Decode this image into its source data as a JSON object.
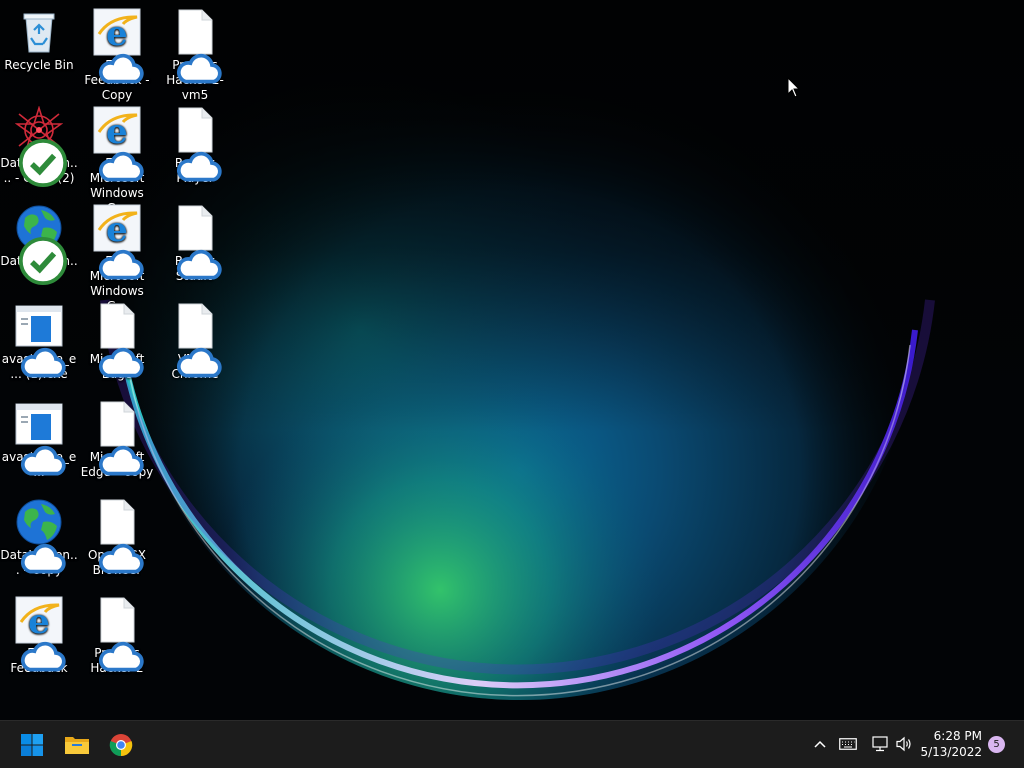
{
  "desktop": {
    "icons": [
      {
        "label": "Recycle Bin",
        "icon": "recycle-bin-icon",
        "badge": "none"
      },
      {
        "label": "EC2 Feedback - Copy",
        "icon": "internet-explorer-icon",
        "badge": "cloud"
      },
      {
        "label": "Process Hacker 2-vm5",
        "icon": "blank-file-icon",
        "badge": "cloud"
      },
      {
        "label": "DataWagon.... - Copy (2)",
        "icon": "red-star-icon",
        "badge": "check"
      },
      {
        "label": "EC2 Microsoft Windows G...",
        "icon": "internet-explorer-icon",
        "badge": "cloud"
      },
      {
        "label": "Roblox Player",
        "icon": "blank-file-icon",
        "badge": "cloud"
      },
      {
        "label": "DataWagon...",
        "icon": "globe-icon",
        "badge": "check"
      },
      {
        "label": "EC2 Microsoft Windows G...",
        "icon": "internet-explorer-icon",
        "badge": "cloud"
      },
      {
        "label": "Roblox Studio",
        "icon": "blank-file-icon",
        "badge": "cloud"
      },
      {
        "label": "avast_one_e... (1).exe",
        "icon": "installer-window-icon",
        "badge": "cloud"
      },
      {
        "label": "Microsoft Edge",
        "icon": "blank-file-icon",
        "badge": "cloud"
      },
      {
        "label": "VM6 - Chrome",
        "icon": "blank-file-icon",
        "badge": "cloud"
      },
      {
        "label": "avast_one_e...",
        "icon": "installer-window-icon",
        "badge": "cloud"
      },
      {
        "label": "Microsoft Edge - Copy",
        "icon": "blank-file-icon",
        "badge": "cloud"
      },
      {
        "label": "DataWagon... - Copy",
        "icon": "globe-icon",
        "badge": "cloud"
      },
      {
        "label": "Opera GX Browser",
        "icon": "blank-file-icon",
        "badge": "cloud"
      },
      {
        "label": "EC2 Feedback",
        "icon": "internet-explorer-icon",
        "badge": "cloud"
      },
      {
        "label": "Process Hacker 2",
        "icon": "blank-file-icon",
        "badge": "cloud"
      }
    ]
  },
  "taskbar": {
    "pinned": [
      {
        "name": "Start",
        "icon": "windows-start-icon"
      },
      {
        "name": "File Explorer",
        "icon": "folder-icon"
      },
      {
        "name": "Google Chrome",
        "icon": "chrome-icon"
      }
    ],
    "tray": [
      "chevron-up-icon",
      "keyboard-icon",
      "network-icon",
      "speaker-icon"
    ],
    "clock": {
      "time": "6:28 PM",
      "date": "5/13/2022"
    },
    "notification_count": "5"
  },
  "colors": {
    "taskbar_bg": "#1c1c1c",
    "wallpaper_glow_cyan": "#00c8d6",
    "wallpaper_glow_green": "#37d06a",
    "wallpaper_rim_purple": "#7b3cff",
    "badge_purple": "#d9b6f0",
    "start_blue": "#0a8ce6"
  }
}
